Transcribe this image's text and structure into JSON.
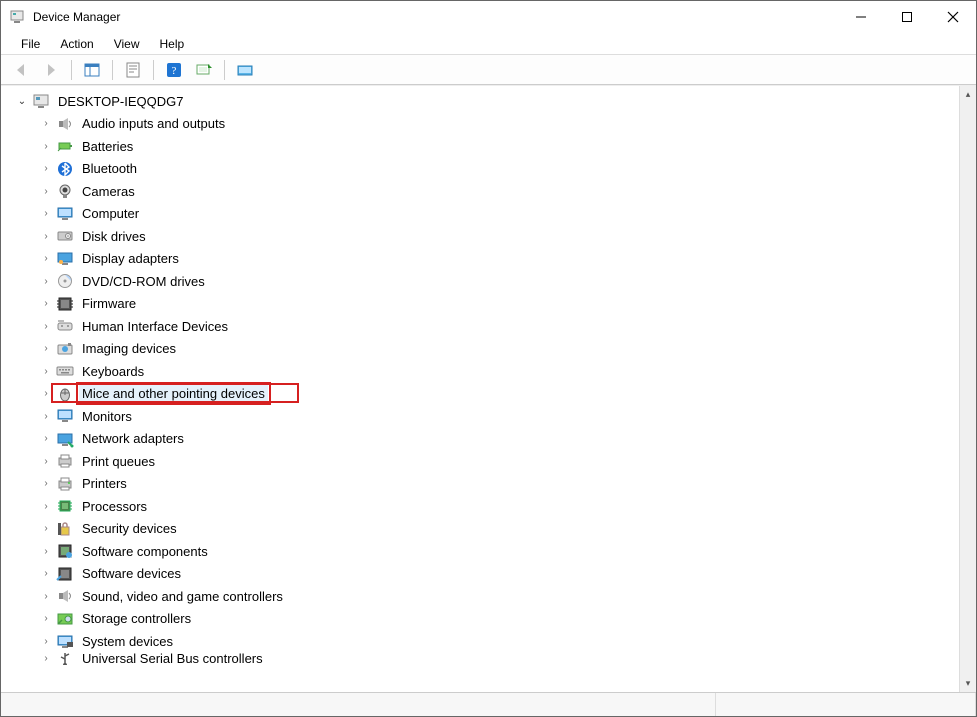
{
  "window": {
    "title": "Device Manager"
  },
  "menus": {
    "file": "File",
    "action": "Action",
    "view": "View",
    "help": "Help"
  },
  "root": {
    "name": "DESKTOP-IEQQDG7"
  },
  "categories": [
    {
      "label": "Audio inputs and outputs",
      "icon": "audio"
    },
    {
      "label": "Batteries",
      "icon": "battery"
    },
    {
      "label": "Bluetooth",
      "icon": "bluetooth"
    },
    {
      "label": "Cameras",
      "icon": "camera"
    },
    {
      "label": "Computer",
      "icon": "computer"
    },
    {
      "label": "Disk drives",
      "icon": "disk"
    },
    {
      "label": "Display adapters",
      "icon": "display"
    },
    {
      "label": "DVD/CD-ROM drives",
      "icon": "dvd"
    },
    {
      "label": "Firmware",
      "icon": "firmware"
    },
    {
      "label": "Human Interface Devices",
      "icon": "hid"
    },
    {
      "label": "Imaging devices",
      "icon": "imaging"
    },
    {
      "label": "Keyboards",
      "icon": "keyboard"
    },
    {
      "label": "Mice and other pointing devices",
      "icon": "mouse",
      "highlighted": true
    },
    {
      "label": "Monitors",
      "icon": "monitor"
    },
    {
      "label": "Network adapters",
      "icon": "network"
    },
    {
      "label": "Print queues",
      "icon": "printqueue"
    },
    {
      "label": "Printers",
      "icon": "printer"
    },
    {
      "label": "Processors",
      "icon": "processor"
    },
    {
      "label": "Security devices",
      "icon": "security"
    },
    {
      "label": "Software components",
      "icon": "swcomp"
    },
    {
      "label": "Software devices",
      "icon": "swdev"
    },
    {
      "label": "Sound, video and game controllers",
      "icon": "sound"
    },
    {
      "label": "Storage controllers",
      "icon": "storage"
    },
    {
      "label": "System devices",
      "icon": "system"
    },
    {
      "label": "Universal Serial Bus controllers",
      "icon": "usb",
      "clipped": true
    }
  ]
}
